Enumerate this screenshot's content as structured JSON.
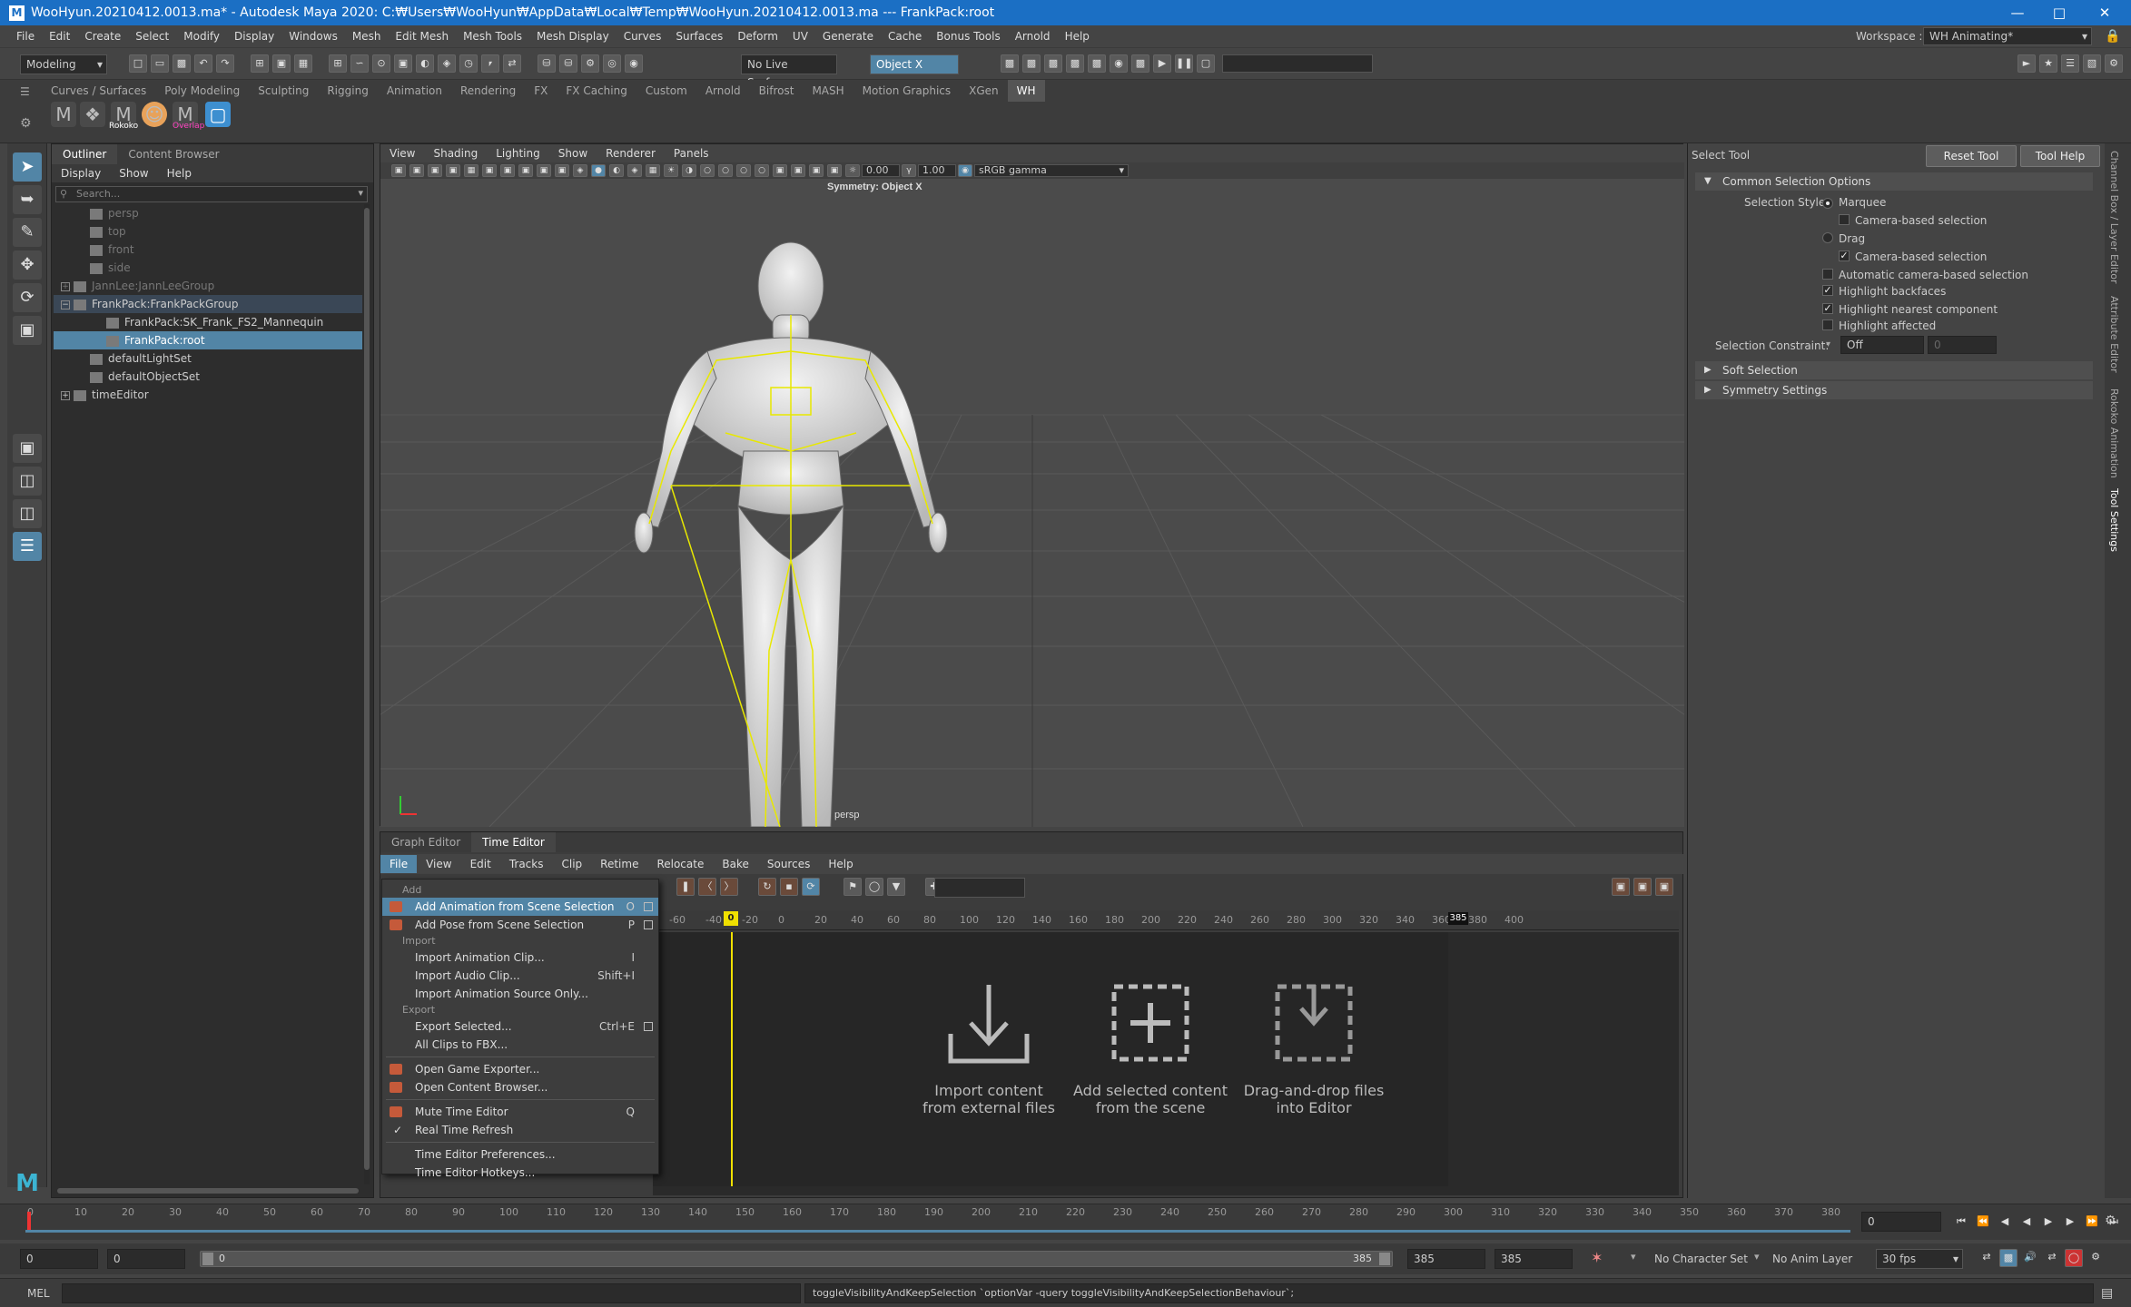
{
  "titlebar": {
    "title": "WooHyun.20210412.0013.ma* - Autodesk Maya 2020: C:₩Users₩WooHyun₩AppData₩Local₩Temp₩WooHyun.20210412.0013.ma   ---   FrankPack:root",
    "logo": "M"
  },
  "menubar": {
    "items": [
      "File",
      "Edit",
      "Create",
      "Select",
      "Modify",
      "Display",
      "Windows",
      "Mesh",
      "Edit Mesh",
      "Mesh Tools",
      "Mesh Display",
      "Curves",
      "Surfaces",
      "Deform",
      "UV",
      "Generate",
      "Cache",
      "Bonus Tools",
      "Arnold",
      "Help"
    ],
    "workspace_label": "Workspace :",
    "workspace_value": "WH Animating*"
  },
  "statusline": {
    "menuset": "Modeling",
    "live_surface": "No Live Surface",
    "symmetry": "Object X"
  },
  "shelf": {
    "tabs": [
      "Curves / Surfaces",
      "Poly Modeling",
      "Sculpting",
      "Rigging",
      "Animation",
      "Rendering",
      "FX",
      "FX Caching",
      "Custom",
      "Arnold",
      "Bifrost",
      "MASH",
      "Motion Graphics",
      "XGen",
      "WH"
    ],
    "active_tab": "WH",
    "labels": [
      "Rokoko",
      "Overlap"
    ]
  },
  "outliner": {
    "tabs": [
      "Outliner",
      "Content Browser"
    ],
    "menus": [
      "Display",
      "Show",
      "Help"
    ],
    "search_placeholder": "Search...",
    "items": [
      {
        "label": "persp",
        "indent": 1,
        "dim": true
      },
      {
        "label": "top",
        "indent": 1,
        "dim": true
      },
      {
        "label": "front",
        "indent": 1,
        "dim": true
      },
      {
        "label": "side",
        "indent": 1,
        "dim": true
      },
      {
        "label": "JannLee:JannLeeGroup",
        "indent": 0,
        "dim": true,
        "expander": "+"
      },
      {
        "label": "FrankPack:FrankPackGroup",
        "indent": 0,
        "expander": "-",
        "highlight": true
      },
      {
        "label": "FrankPack:SK_Frank_FS2_Mannequin",
        "indent": 2
      },
      {
        "label": "FrankPack:root",
        "indent": 2,
        "selected": true
      },
      {
        "label": "defaultLightSet",
        "indent": 1
      },
      {
        "label": "defaultObjectSet",
        "indent": 1
      },
      {
        "label": "timeEditor",
        "indent": 0,
        "expander": "+"
      }
    ]
  },
  "viewport": {
    "menus": [
      "View",
      "Shading",
      "Lighting",
      "Show",
      "Renderer",
      "Panels"
    ],
    "exposure": "0.00",
    "gamma": "1.00",
    "colorspace": "sRGB gamma",
    "hud_symmetry": "Symmetry: Object X",
    "camera": "persp"
  },
  "time_editor": {
    "tabs": [
      "Graph Editor",
      "Time Editor"
    ],
    "menus": [
      "File",
      "View",
      "Edit",
      "Tracks",
      "Clip",
      "Retime",
      "Relocate",
      "Bake",
      "Sources",
      "Help"
    ],
    "ruler_ticks": [
      "-60",
      "-40",
      "-20",
      "0",
      "20",
      "40",
      "60",
      "80",
      "100",
      "120",
      "140",
      "160",
      "180",
      "200",
      "220",
      "240",
      "260",
      "280",
      "300",
      "320",
      "340",
      "360",
      "380",
      "400"
    ],
    "current_frame": "0",
    "end_marker": "385",
    "hints": [
      {
        "line1": "Import content",
        "line2": "from external files",
        "icon": "import-arrow-icon"
      },
      {
        "line1": "Add selected content",
        "line2": "from the scene",
        "icon": "add-plus-icon"
      },
      {
        "line1": "Drag-and-drop files",
        "line2": "into Editor",
        "icon": "drop-box-icon"
      }
    ]
  },
  "file_menu": {
    "items": [
      {
        "type": "section",
        "label": "Add"
      },
      {
        "type": "item",
        "label": "Add Animation from Scene Selection",
        "shortcut": "O",
        "optionbox": true,
        "selected": true,
        "icon": true
      },
      {
        "type": "item",
        "label": "Add Pose from Scene Selection",
        "shortcut": "P",
        "optionbox": true,
        "icon": true
      },
      {
        "type": "section",
        "label": "Import"
      },
      {
        "type": "item",
        "label": "Import Animation Clip...",
        "shortcut": "I"
      },
      {
        "type": "item",
        "label": "Import Audio Clip...",
        "shortcut": "Shift+I"
      },
      {
        "type": "item",
        "label": "Import Animation Source Only..."
      },
      {
        "type": "section",
        "label": "Export"
      },
      {
        "type": "item",
        "label": "Export Selected...",
        "shortcut": "Ctrl+E",
        "optionbox": true
      },
      {
        "type": "item",
        "label": "All Clips to FBX..."
      },
      {
        "type": "divider"
      },
      {
        "type": "item",
        "label": "Open Game Exporter...",
        "icon": true
      },
      {
        "type": "item",
        "label": "Open Content Browser...",
        "icon": true
      },
      {
        "type": "divider"
      },
      {
        "type": "item",
        "label": "Mute Time Editor",
        "shortcut": "Q",
        "icon": true
      },
      {
        "type": "item",
        "label": "Real Time Refresh",
        "check": true
      },
      {
        "type": "divider"
      },
      {
        "type": "item",
        "label": "Time Editor Preferences..."
      },
      {
        "type": "item",
        "label": "Time Editor Hotkeys..."
      }
    ]
  },
  "tool_settings": {
    "title": "Select Tool",
    "reset_button": "Reset Tool",
    "help_button": "Tool Help",
    "section_common": "Common Selection Options",
    "selection_style_label": "Selection Style:",
    "marquee": "Marquee",
    "camera_based_1": "Camera-based selection",
    "drag": "Drag",
    "camera_based_2": "Camera-based selection",
    "auto_camera": "Automatic camera-based selection",
    "highlight_backfaces": "Highlight backfaces",
    "highlight_nearest": "Highlight nearest component",
    "highlight_affected": "Highlight affected",
    "constraint_label": "Selection Constraint:",
    "constraint_value": "Off",
    "constraint_num": "0",
    "section_soft": "Soft Selection",
    "section_symmetry": "Symmetry Settings"
  },
  "side_tabs": [
    "Channel Box / Layer Editor",
    "Attribute Editor",
    "Rokoko Animation",
    "Tool Settings"
  ],
  "time_slider": {
    "ticks": [
      "0",
      "10",
      "20",
      "30",
      "40",
      "50",
      "60",
      "70",
      "80",
      "90",
      "100",
      "110",
      "120",
      "130",
      "140",
      "150",
      "160",
      "170",
      "180",
      "190",
      "200",
      "210",
      "220",
      "230",
      "240",
      "250",
      "260",
      "270",
      "280",
      "290",
      "300",
      "310",
      "320",
      "330",
      "340",
      "350",
      "360",
      "370",
      "380"
    ],
    "current_frame": "0"
  },
  "range_slider": {
    "start": "0",
    "start2": "0",
    "range_start_label": "0",
    "range_end_label": "385",
    "end": "385",
    "end2": "385",
    "character_set": "No Character Set",
    "anim_layer": "No Anim Layer",
    "fps": "30 fps"
  },
  "cmdline": {
    "mel_label": "MEL",
    "feedback": "toggleVisibilityAndKeepSelection `optionVar -query toggleVisibilityAndKeepSelectionBehaviour`;"
  },
  "colors": {
    "accent": "#5285a6",
    "titlebar": "#1b6fc4",
    "skeleton": "#e8e800",
    "timeline_marker": "#f0e000"
  }
}
